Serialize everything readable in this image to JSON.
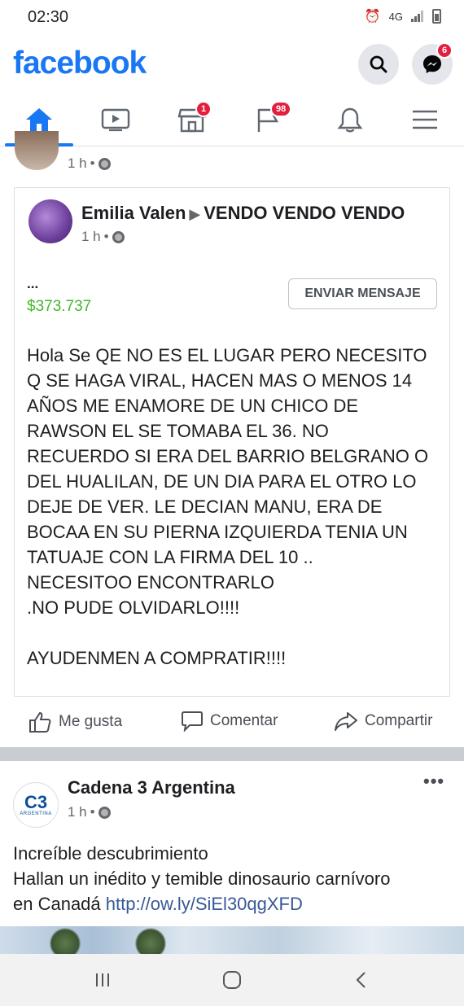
{
  "status_bar": {
    "time": "02:30",
    "network": "4G"
  },
  "header": {
    "logo": "facebook",
    "messenger_badge": "6"
  },
  "nav": {
    "marketplace_badge": "1",
    "pages_badge": "98"
  },
  "prev_post": {
    "time": "1 h",
    "separator": "•"
  },
  "shared_post": {
    "author": "Emilia Valen",
    "arrow": "▶",
    "group": "VENDO VENDO VENDO",
    "time": "1 h",
    "separator": "•",
    "ellipsis": "...",
    "price": "$373.737",
    "send_message_label": "ENVIAR MENSAJE",
    "body_lines": [
      "Hola Se QE NO ES EL LUGAR PERO NECESITO",
      "Q SE HAGA VIRAL,  HACEN MAS O MENOS 14",
      "AÑOS  ME ENAMORE DE UN CHICO DE",
      "RAWSON EL SE TOMABA EL 36. NO",
      "RECUERDO SI ERA DEL BARRIO BELGRANO O",
      "DEL HUALILAN, DE UN DIA PARA EL OTRO LO",
      "DEJE DE VER. LE DECIAN MANU,  ERA DE",
      "BOCAA EN SU PIERNA IZQUIERDA TENIA UN",
      "TATUAJE CON LA FIRMA DEL 10 ..",
      "NECESITOO ENCONTRARLO",
      ".NO PUDE OLVIDARLO!!!!",
      "",
      "AYUDENMEN A COMPRATIR!!!!"
    ]
  },
  "actions": {
    "like_label": "Me gusta",
    "comment_label": "Comentar",
    "share_label": "Compartir"
  },
  "post2": {
    "author": "Cadena 3 Argentina",
    "logo_text": "C3",
    "logo_sub": "ARGENTINA",
    "time": "1 h",
    "separator": "•",
    "more": "•••",
    "line1": "Increíble descubrimiento",
    "line2": "Hallan un inédito y temible dinosaurio carnívoro",
    "line3_text": "en Canadá ",
    "link": "http://ow.ly/SiEl30qgXFD"
  },
  "colors": {
    "brand": "#1877f2",
    "price": "#42b72a",
    "badge": "#e41e3f",
    "link": "#385898"
  }
}
